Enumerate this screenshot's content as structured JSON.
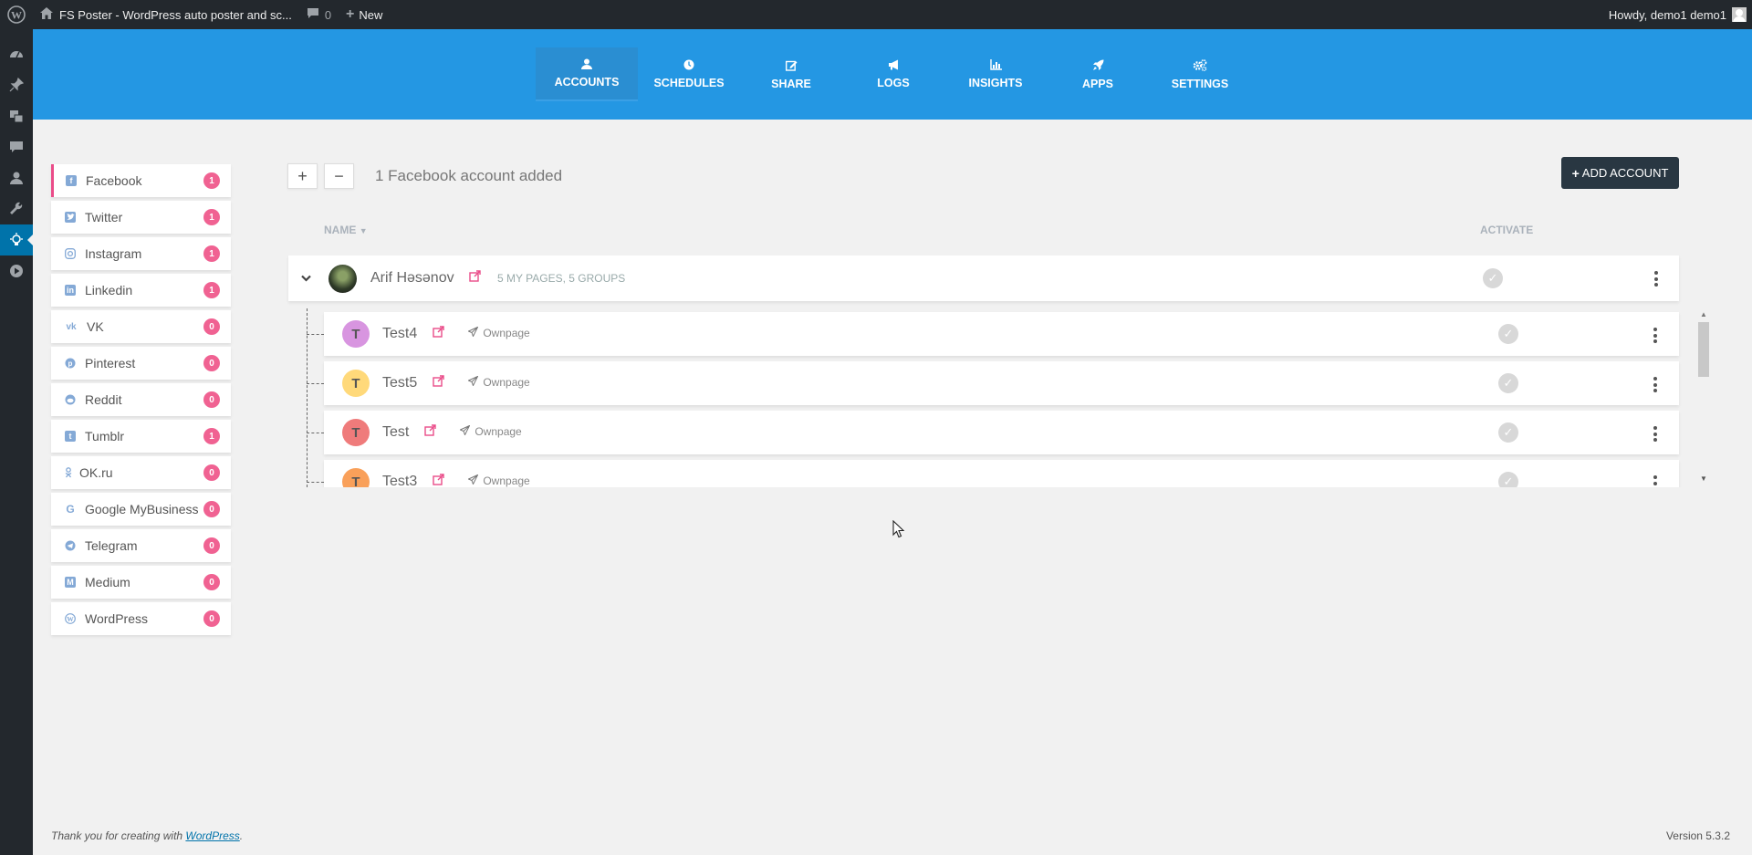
{
  "adminbar": {
    "site_title": "FS Poster - WordPress auto poster and sc...",
    "comments_count": "0",
    "new_label": "New",
    "howdy": "Howdy, demo1 demo1"
  },
  "adminmenu": {
    "items": [
      "dashboard-icon",
      "pin-icon",
      "media-icon",
      "comments-icon",
      "users-icon",
      "tools-icon",
      "fs-poster-icon",
      "play-icon"
    ]
  },
  "nav": {
    "tabs": [
      {
        "label": "ACCOUNTS",
        "icon": "user-icon",
        "active": true
      },
      {
        "label": "SCHEDULES",
        "icon": "clock-icon"
      },
      {
        "label": "SHARE",
        "icon": "edit-icon"
      },
      {
        "label": "LOGS",
        "icon": "bullhorn-icon"
      },
      {
        "label": "INSIGHTS",
        "icon": "bar-chart-icon"
      },
      {
        "label": "APPS",
        "icon": "rocket-icon"
      },
      {
        "label": "SETTINGS",
        "icon": "gears-icon"
      }
    ]
  },
  "networks": [
    {
      "label": "Facebook",
      "count": "1",
      "active": true
    },
    {
      "label": "Twitter",
      "count": "1"
    },
    {
      "label": "Instagram",
      "count": "1"
    },
    {
      "label": "Linkedin",
      "count": "1"
    },
    {
      "label": "VK",
      "count": "0"
    },
    {
      "label": "Pinterest",
      "count": "0"
    },
    {
      "label": "Reddit",
      "count": "0"
    },
    {
      "label": "Tumblr",
      "count": "1"
    },
    {
      "label": "OK.ru",
      "count": "0"
    },
    {
      "label": "Google MyBusiness",
      "count": "0"
    },
    {
      "label": "Telegram",
      "count": "0"
    },
    {
      "label": "Medium",
      "count": "0"
    },
    {
      "label": "WordPress",
      "count": "0"
    }
  ],
  "main": {
    "count_text": "1 Facebook account added",
    "add_account_label": "ADD ACCOUNT",
    "col_name": "NAME",
    "col_activate": "ACTIVATE",
    "account": {
      "name": "Arif Həsənov",
      "meta": "5 MY PAGES, 5 GROUPS"
    },
    "pages": [
      {
        "initial": "T",
        "name": "Test4",
        "type": "Ownpage",
        "color": "#d895e0"
      },
      {
        "initial": "T",
        "name": "Test5",
        "type": "Ownpage",
        "color": "#ffd97a"
      },
      {
        "initial": "T",
        "name": "Test",
        "type": "Ownpage",
        "color": "#ef7b7b"
      },
      {
        "initial": "T",
        "name": "Test3",
        "type": "Ownpage",
        "color": "#f9a05a"
      }
    ]
  },
  "footer": {
    "thanks_prefix": "Thank you for creating with ",
    "thanks_link": "WordPress",
    "thanks_suffix": ".",
    "version": "Version 5.3.2"
  },
  "colors": {
    "brand_blue": "#2497e3",
    "badge_pink": "#f06292",
    "dark_button": "#293742"
  }
}
